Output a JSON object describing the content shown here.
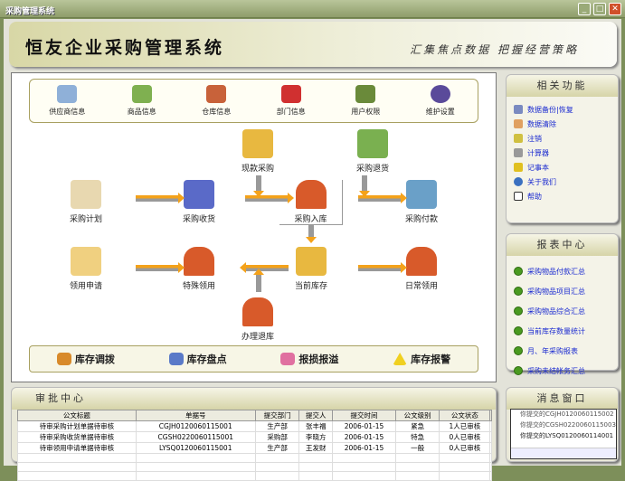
{
  "window": {
    "title": "采购管理系统",
    "minimize": "_",
    "maximize": "□",
    "close": "✕"
  },
  "banner": {
    "title": "恒友企业采购管理系统",
    "slogan": "汇集焦点数据 把握经营策略"
  },
  "toolbar": [
    {
      "label": "供应商信息",
      "icon": "supplier-icon",
      "color": "#8fb0d8"
    },
    {
      "label": "商品信息",
      "icon": "goods-icon",
      "color": "#7fb050"
    },
    {
      "label": "仓库信息",
      "icon": "warehouse-icon",
      "color": "#c8623a"
    },
    {
      "label": "部门信息",
      "icon": "department-icon",
      "color": "#d03030"
    },
    {
      "label": "用户权限",
      "icon": "user-icon",
      "color": "#6a8a3a"
    },
    {
      "label": "维护设置",
      "icon": "settings-icon",
      "color": "#5a4a9a"
    }
  ],
  "flow": {
    "plan": "采购计划",
    "receive": "采购收货",
    "cash": "现款采购",
    "instock": "采购入库",
    "return": "采购退货",
    "pay": "采购付款",
    "apply": "领用申请",
    "special": "特殊领用",
    "current": "当前库存",
    "daily": "日常领用",
    "back": "办理退库"
  },
  "bottom_tools": [
    "库存调拨",
    "库存盘点",
    "报损报溢",
    "库存报警"
  ],
  "related": {
    "title": "相关功能",
    "items": [
      "数据备份|恢复",
      "数据清除",
      "注销",
      "计算器",
      "记事本",
      "关于我们",
      "帮助"
    ]
  },
  "reports": {
    "title": "报表中心",
    "items": [
      "采购物品付款汇总",
      "采购物品项目汇总",
      "采购物品综合汇总",
      "当前库存数量统计",
      "月、年采购报表",
      "采购未结帐务汇总"
    ]
  },
  "approval": {
    "title": "审批中心",
    "columns": [
      "公文标题",
      "单据号",
      "提交部门",
      "提交人",
      "提交时间",
      "公文级别",
      "公文状态"
    ],
    "rows": [
      [
        "待审采购计划单据待审核",
        "CGJH0120060115001",
        "生产部",
        "张丰福",
        "2006-01-15",
        "紧急",
        "1人已审核"
      ],
      [
        "待审采购收货单据待审核",
        "CGSH0220060115001",
        "采购部",
        "李晓方",
        "2006-01-15",
        "特急",
        "0人已审核"
      ],
      [
        "待审领用申请单据待审核",
        "LYSQ0120060115001",
        "生产部",
        "王发财",
        "2006-01-15",
        "一般",
        "0人已审核"
      ]
    ]
  },
  "messages": {
    "title": "消息窗口",
    "items": [
      "你提交的CGJH0120060115002",
      "你提交的CGSH0220060115003",
      "你提交的LYSQ0120060114001"
    ]
  }
}
